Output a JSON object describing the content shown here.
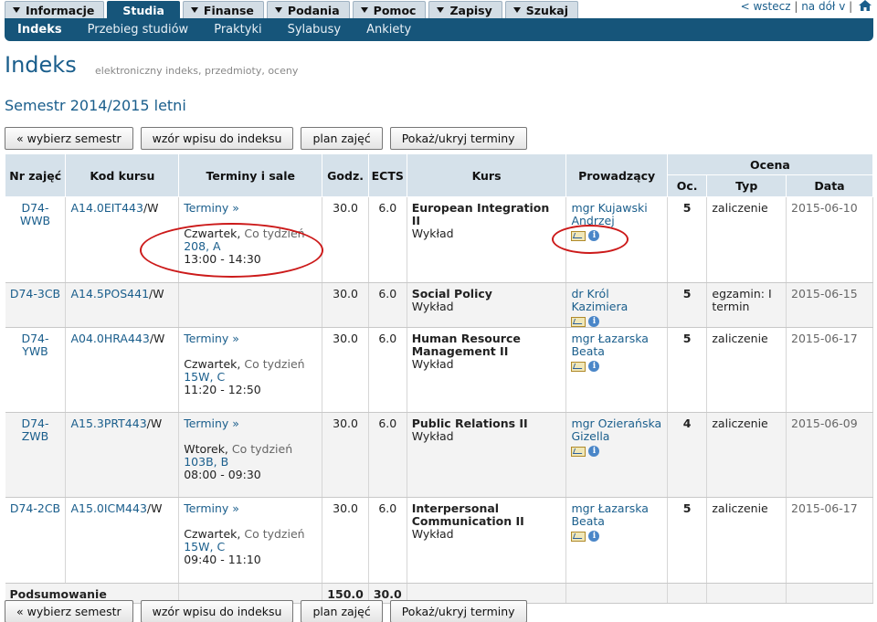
{
  "top_tabs": [
    "Informacje",
    "Studia",
    "Finanse",
    "Podania",
    "Pomoc",
    "Zapisy",
    "Szukaj"
  ],
  "top_right": {
    "back": "< wstecz",
    "forward": "na dół",
    "sep1": "|",
    "sep2": "|"
  },
  "subnav": [
    "Indeks",
    "Przebieg studiów",
    "Praktyki",
    "Sylabusy",
    "Ankiety"
  ],
  "page": {
    "title": "Indeks",
    "subtitle": "elektroniczny indeks, przedmioty, oceny",
    "semester": "Semestr 2014/2015 letni"
  },
  "buttons": {
    "choose_semester": "« wybierz semestr",
    "entry_template": "wzór wpisu do indeksu",
    "schedule": "plan zajęć",
    "toggle_terms": "Pokaż/ukryj terminy"
  },
  "table": {
    "headers": {
      "nr": "Nr zajęć",
      "kod": "Kod kursu",
      "terminy": "Terminy i sale",
      "godz": "Godz.",
      "ects": "ECTS",
      "kurs": "Kurs",
      "prowadzacy": "Prowadzący",
      "ocena": "Ocena",
      "oc": "Oc.",
      "typ": "Typ",
      "data": "Data"
    },
    "rows": [
      {
        "nr": "D74-WWB",
        "kod_link": "A14.0EIT443",
        "kod_suffix": "/W",
        "terminy_link": "Terminy »",
        "day": "Czwartek,",
        "freq": "Co tydzień",
        "room": "208, A",
        "time": "13:00 - 14:30",
        "godz": "30.0",
        "ects": "6.0",
        "kurs": "European Integration II",
        "forma": "Wykład",
        "prowadzacy": "mgr Kujawski Andrzej",
        "oc": "5",
        "typ": "zaliczenie",
        "data": "2015-06-10"
      },
      {
        "nr": "D74-3CB",
        "kod_link": "A14.5POS441",
        "kod_suffix": "/W",
        "terminy_link": "",
        "day": "",
        "freq": "",
        "room": "",
        "time": "",
        "godz": "30.0",
        "ects": "6.0",
        "kurs": "Social Policy",
        "forma": "Wykład",
        "prowadzacy": "dr Król Kazimiera",
        "oc": "5",
        "typ": "egzamin: I termin",
        "data": "2015-06-15"
      },
      {
        "nr": "D74-YWB",
        "kod_link": "A04.0HRA443",
        "kod_suffix": "/W",
        "terminy_link": "Terminy »",
        "day": "Czwartek,",
        "freq": "Co tydzień",
        "room": "15W, C",
        "time": "11:20 - 12:50",
        "godz": "30.0",
        "ects": "6.0",
        "kurs": "Human Resource Management II",
        "forma": "Wykład",
        "prowadzacy": "mgr Łazarska Beata",
        "oc": "5",
        "typ": "zaliczenie",
        "data": "2015-06-17"
      },
      {
        "nr": "D74-ZWB",
        "kod_link": "A15.3PRT443",
        "kod_suffix": "/W",
        "terminy_link": "Terminy »",
        "day": "Wtorek,",
        "freq": "Co tydzień",
        "room": "103B, B",
        "time": "08:00 - 09:30",
        "godz": "30.0",
        "ects": "6.0",
        "kurs": "Public Relations II",
        "forma": "Wykład",
        "prowadzacy": "mgr Ozierańska Gizella",
        "oc": "4",
        "typ": "zaliczenie",
        "data": "2015-06-09"
      },
      {
        "nr": "D74-2CB",
        "kod_link": "A15.0ICM443",
        "kod_suffix": "/W",
        "terminy_link": "Terminy »",
        "day": "Czwartek,",
        "freq": "Co tydzień",
        "room": "15W, C",
        "time": "09:40 - 11:10",
        "godz": "30.0",
        "ects": "6.0",
        "kurs": "Interpersonal Communication II",
        "forma": "Wykład",
        "prowadzacy": "mgr Łazarska Beata",
        "oc": "5",
        "typ": "zaliczenie",
        "data": "2015-06-17"
      }
    ],
    "summary": {
      "label": "Podsumowanie",
      "godz": "150.0",
      "ects": "30.0"
    }
  },
  "icons": {
    "mail": "mail-icon",
    "info": "info-icon",
    "home": "home-icon"
  },
  "colors": {
    "accent": "#16557a",
    "link": "#1a5e8c",
    "annotation": "#cc1a1a"
  }
}
